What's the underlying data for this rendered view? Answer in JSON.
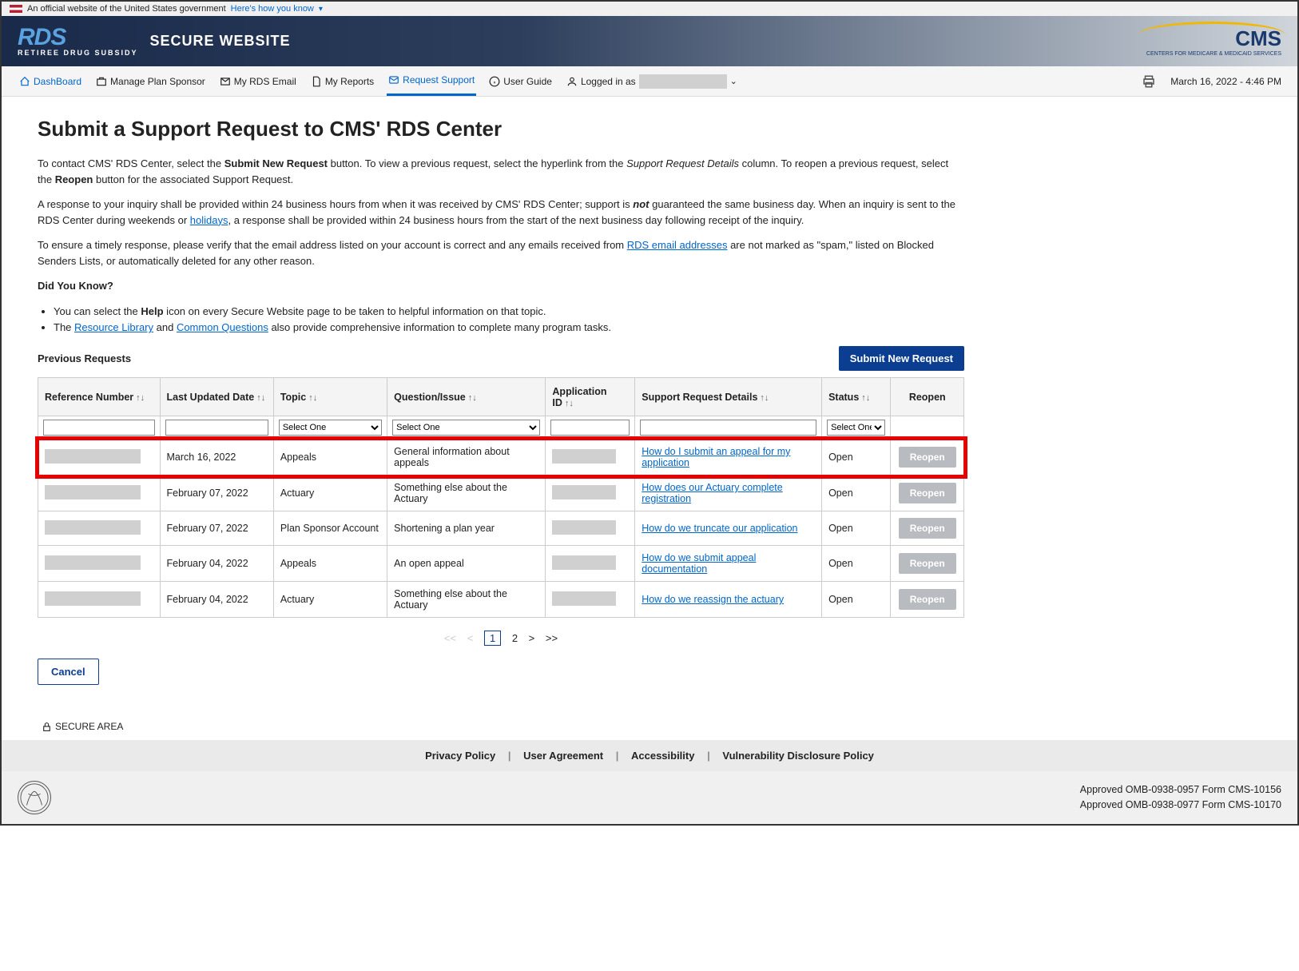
{
  "gov_banner": {
    "text": "An official website of the United States government",
    "link": "Here's how you know"
  },
  "brand": {
    "rds_sub": "RETIREE DRUG SUBSIDY",
    "secure": "SECURE WEBSITE",
    "cms": "CMS",
    "cms_sub": "CENTERS FOR MEDICARE & MEDICAID SERVICES"
  },
  "nav": {
    "dashboard": "DashBoard",
    "manage": "Manage Plan Sponsor",
    "email": "My RDS Email",
    "reports": "My Reports",
    "support": "Request Support",
    "guide": "User Guide",
    "logged": "Logged in as",
    "timestamp": "March 16, 2022 - 4:46 PM"
  },
  "page": {
    "title": "Submit a Support Request to CMS' RDS Center",
    "p1_a": "To contact CMS' RDS Center, select the ",
    "p1_b": "Submit New Request",
    "p1_c": " button. To view a previous request, select the hyperlink from the ",
    "p1_d": "Support Request Details",
    "p1_e": " column. To reopen a previous request, select the ",
    "p1_f": "Reopen",
    "p1_g": " button for the associated Support Request.",
    "p2_a": "A response to your inquiry shall be provided within 24 business hours from when it was received by CMS' RDS Center; support is ",
    "p2_b": "not",
    "p2_c": " guaranteed the same business day. When an inquiry is sent to the RDS Center during weekends or ",
    "p2_d": "holidays",
    "p2_e": ", a response shall be provided within 24 business hours from the start of the next business day following receipt of the inquiry.",
    "p3_a": "To ensure a timely response, please verify that the email address listed on your account is correct and any emails received from ",
    "p3_b": "RDS email addresses",
    "p3_c": " are not marked as \"spam,\" listed on Blocked Senders Lists, or automatically deleted for any other reason.",
    "dyk": "Did You Know?",
    "li1_a": "You can select the ",
    "li1_b": "Help",
    "li1_c": " icon on every Secure Website page to be taken to helpful information on that topic.",
    "li2_a": "The ",
    "li2_b": "Resource Library",
    "li2_c": " and ",
    "li2_d": "Common Questions",
    "li2_e": " also provide comprehensive information to complete many program tasks.",
    "prev": "Previous Requests",
    "submit_btn": "Submit New Request",
    "cancel": "Cancel"
  },
  "table": {
    "headers": {
      "ref": "Reference Number",
      "date": "Last Updated Date",
      "topic": "Topic",
      "question": "Question/Issue",
      "app": "Application ID",
      "details": "Support Request Details",
      "status": "Status",
      "reopen": "Reopen"
    },
    "select_one": "Select One",
    "reopen_btn": "Reopen",
    "rows": [
      {
        "date": "March 16, 2022",
        "topic": "Appeals",
        "question": "General information about appeals",
        "details": "How do I submit an appeal for my application",
        "status": "Open"
      },
      {
        "date": "February 07, 2022",
        "topic": "Actuary",
        "question": "Something else about the Actuary",
        "details": "How does our Actuary complete registration",
        "status": "Open"
      },
      {
        "date": "February 07, 2022",
        "topic": "Plan Sponsor Account",
        "question": "Shortening a plan year",
        "details": "How do we truncate our application",
        "status": "Open"
      },
      {
        "date": "February 04, 2022",
        "topic": "Appeals",
        "question": "An open appeal",
        "details": "How do we submit appeal documentation",
        "status": "Open"
      },
      {
        "date": "February 04, 2022",
        "topic": "Actuary",
        "question": "Something else about the Actuary",
        "details": "How do we reassign the actuary",
        "status": "Open"
      }
    ]
  },
  "pagination": {
    "p1": "1",
    "p2": "2"
  },
  "secure_area": "SECURE AREA",
  "footer": {
    "privacy": "Privacy Policy",
    "user": "User Agreement",
    "access": "Accessibility",
    "vuln": "Vulnerability Disclosure Policy",
    "omb1": "Approved OMB-0938-0957 Form CMS-10156",
    "omb2": "Approved OMB-0938-0977 Form CMS-10170"
  }
}
